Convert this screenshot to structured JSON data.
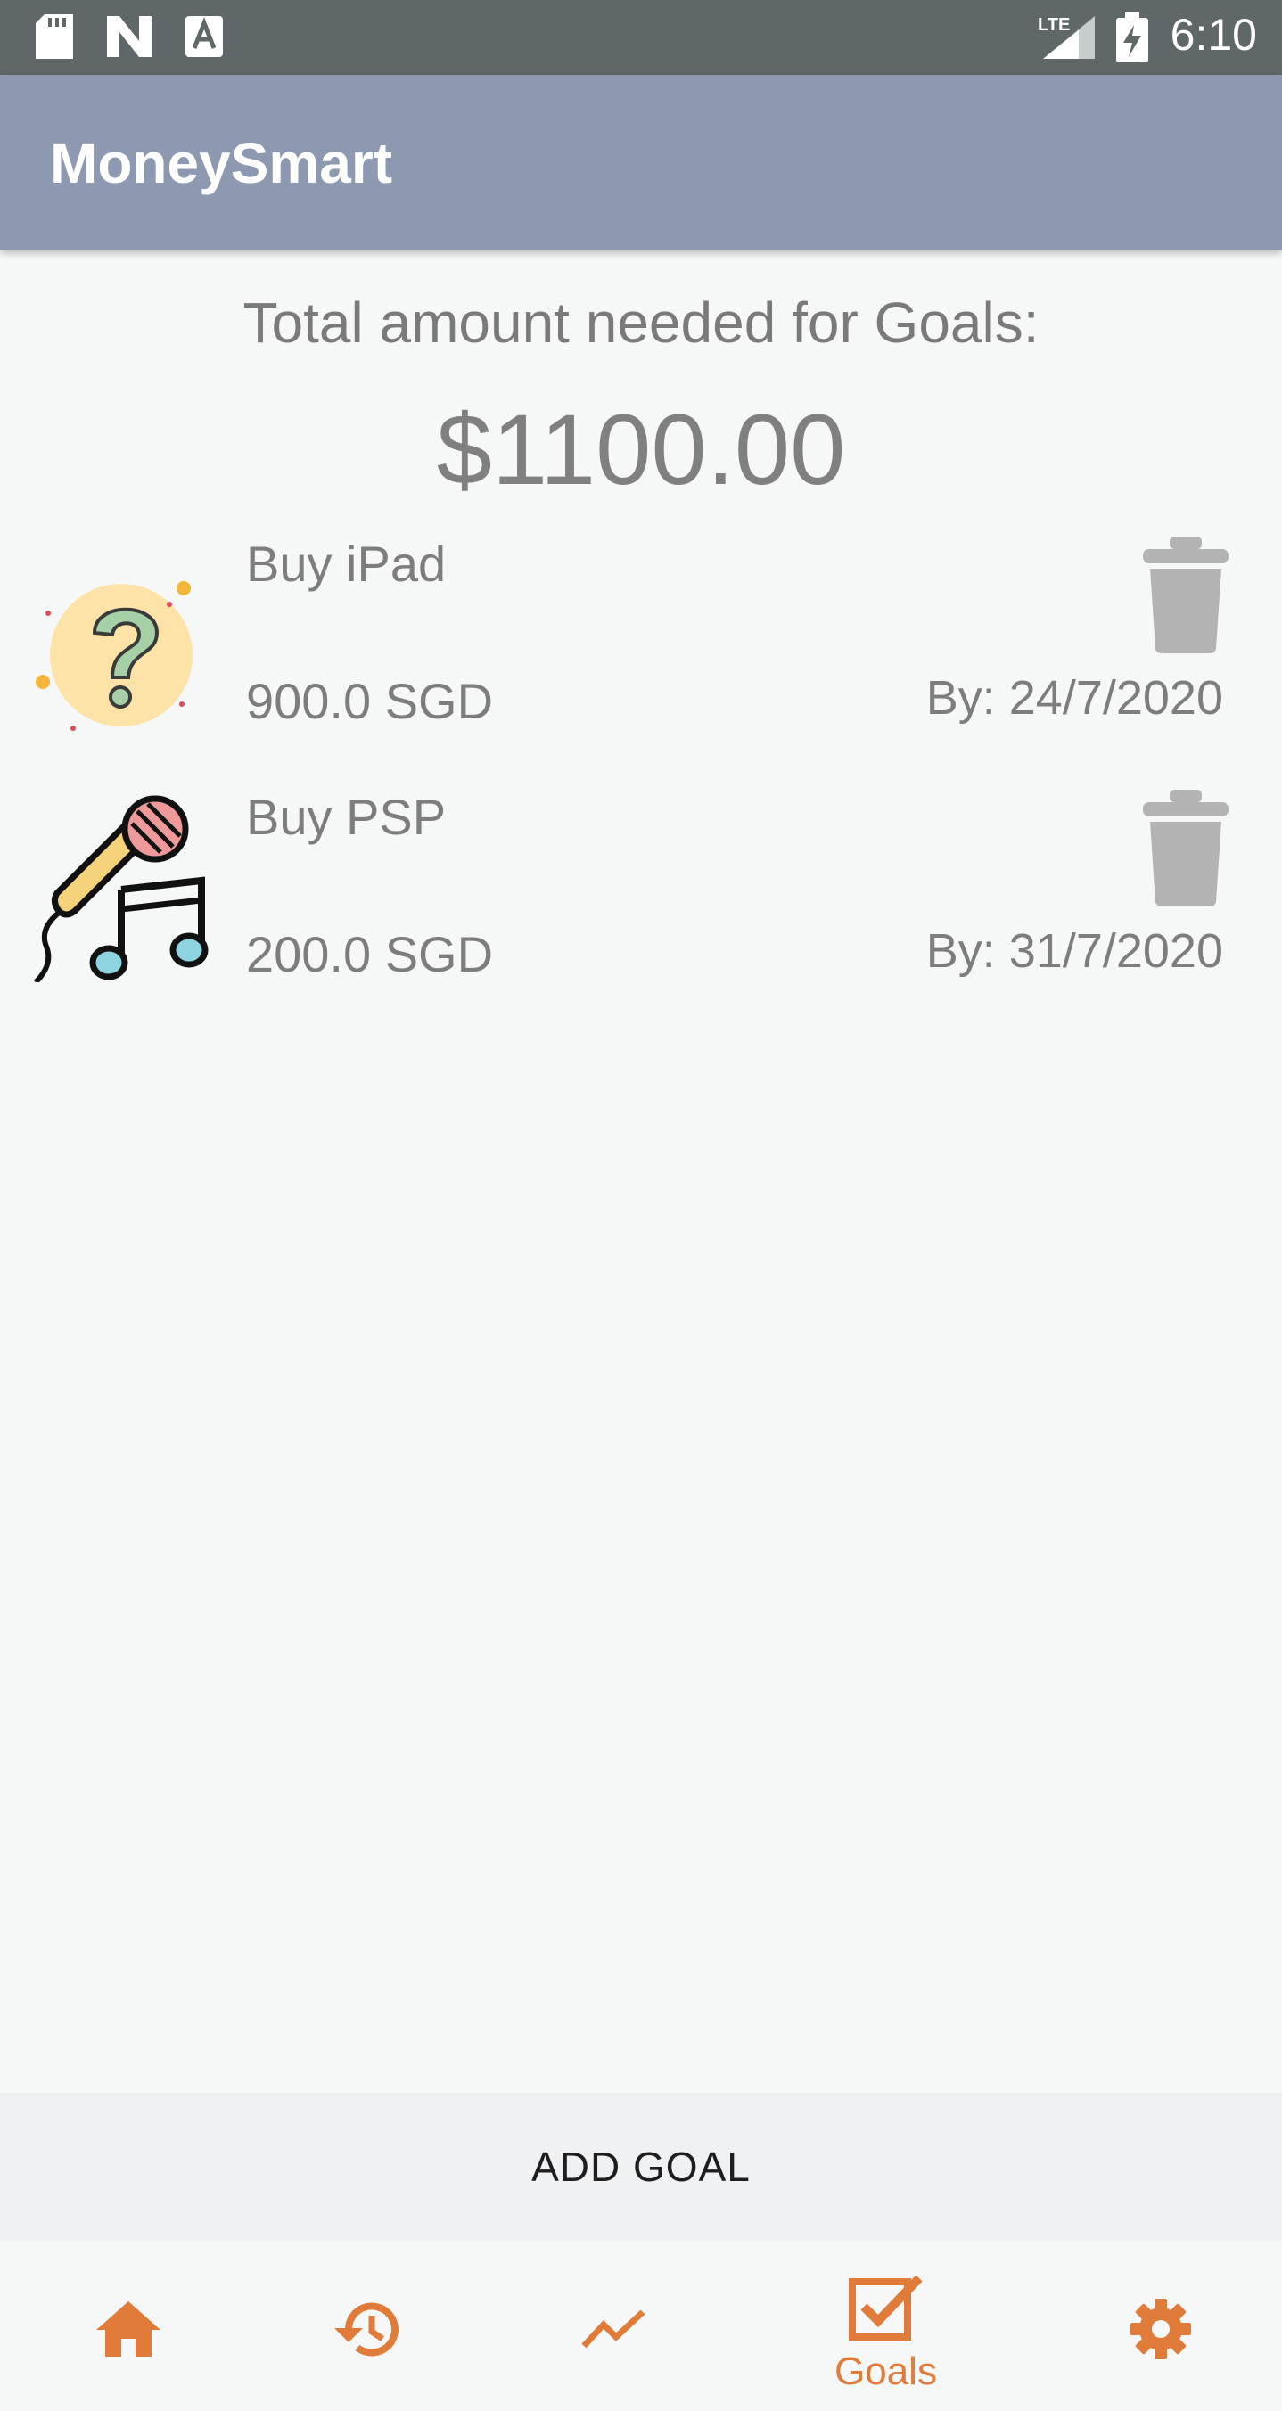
{
  "status_bar": {
    "time": "6:10",
    "network": "LTE",
    "icons": [
      "sd-card-icon",
      "n-icon",
      "a-icon",
      "signal-icon",
      "battery-charging-icon"
    ]
  },
  "app_bar": {
    "title": "MoneySmart"
  },
  "summary": {
    "label": "Total amount needed for Goals:",
    "value": "$1100.00"
  },
  "goals": [
    {
      "title": "Buy iPad",
      "amount": "900.0 SGD",
      "date": "By: 24/7/2020",
      "icon": "question-mark-icon"
    },
    {
      "title": "Buy PSP",
      "amount": "200.0 SGD",
      "date": "By: 31/7/2020",
      "icon": "microphone-music-icon"
    }
  ],
  "add_button": {
    "label": "ADD GOAL"
  },
  "bottom_nav": {
    "items": [
      {
        "icon": "home-icon",
        "label": ""
      },
      {
        "icon": "history-icon",
        "label": ""
      },
      {
        "icon": "trending-icon",
        "label": ""
      },
      {
        "icon": "goals-check-icon",
        "label": "Goals",
        "selected": true
      },
      {
        "icon": "settings-icon",
        "label": ""
      }
    ]
  },
  "colors": {
    "status_bar": "#5f6769",
    "app_bar": "#8c99b0",
    "accent": "#e07b39",
    "background": "#f6f8f8"
  }
}
